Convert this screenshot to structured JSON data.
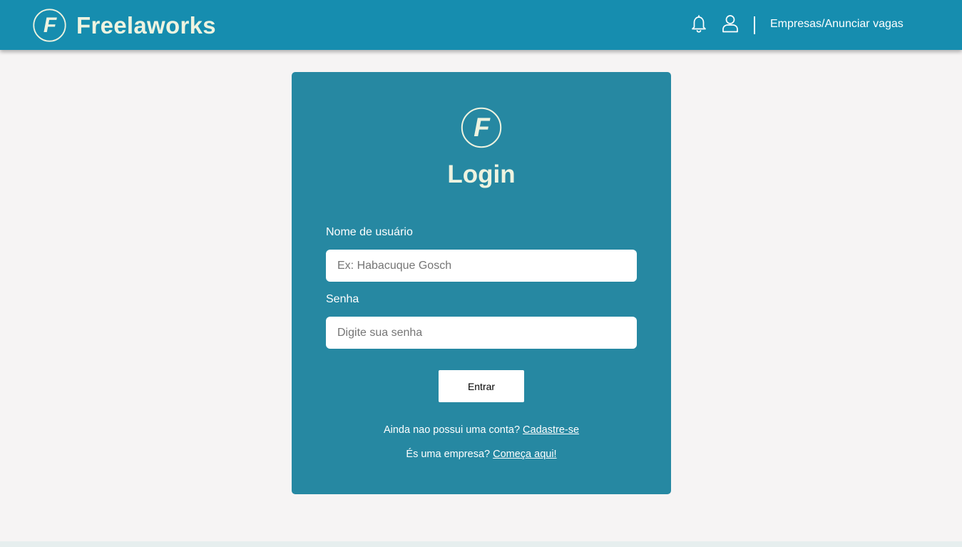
{
  "header": {
    "brand_name": "Freelaworks",
    "brand_logo_letter": "F",
    "icons": [
      "bell-icon",
      "user-icon"
    ],
    "companies_link": "Empresas/Anunciar vagas"
  },
  "login": {
    "logo_letter": "F",
    "title": "Login",
    "username_label": "Nome de usuário",
    "username_placeholder": "Ex: Habacuque Gosch",
    "username_value": "",
    "password_label": "Senha",
    "password_placeholder": "Digite sua senha",
    "password_value": "",
    "submit_label": "Entrar",
    "signup_prompt": "Ainda nao possui uma conta?",
    "signup_link": "Cadastre-se",
    "company_prompt": "És uma empresa?",
    "company_link": "Começa aqui!"
  },
  "colors": {
    "header_bg": "#168daf",
    "card_bg": "#2688a2",
    "brand_text": "#eef3e0",
    "page_bg": "#f6f4f4"
  }
}
